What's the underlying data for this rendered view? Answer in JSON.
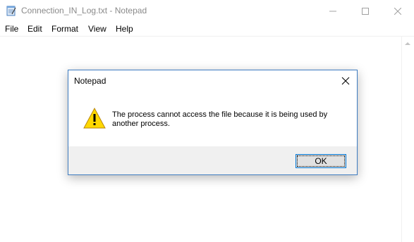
{
  "window": {
    "title": "Connection_IN_Log.txt - Notepad",
    "icon": "notepad-icon"
  },
  "menu": {
    "items": [
      "File",
      "Edit",
      "Format",
      "View",
      "Help"
    ]
  },
  "dialog": {
    "title": "Notepad",
    "icon": "warning-icon",
    "message": "The process cannot access the file because it is being used by another process.",
    "ok_label": "OK"
  },
  "colors": {
    "dialog_border": "#3e7cc1",
    "ok_border": "#0078d7",
    "warning_fill": "#ffd800",
    "footer_bg": "#f0f0f0"
  }
}
